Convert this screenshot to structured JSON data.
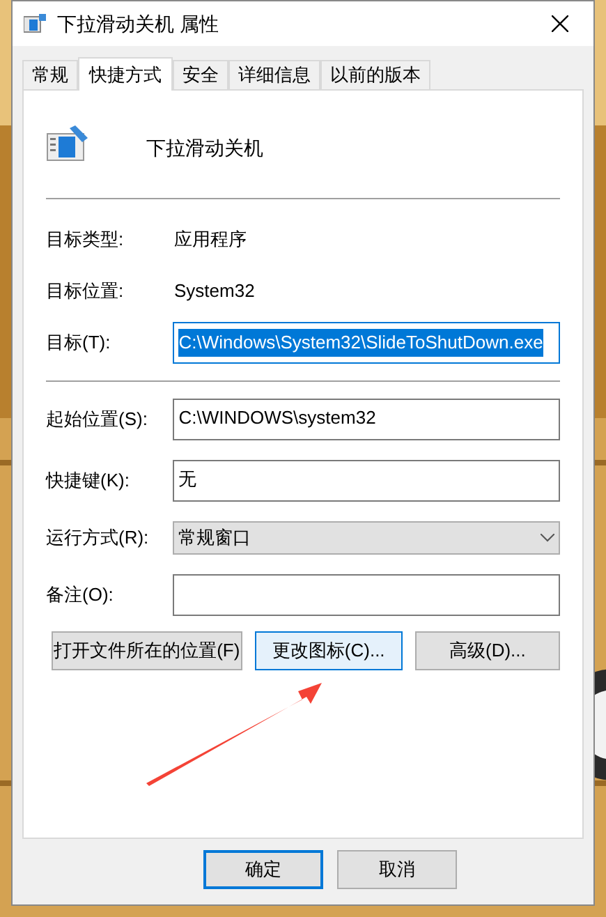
{
  "window": {
    "title": "下拉滑动关机 属性"
  },
  "tabs": [
    {
      "label": "常规",
      "selected": false
    },
    {
      "label": "快捷方式",
      "selected": true
    },
    {
      "label": "安全",
      "selected": false
    },
    {
      "label": "详细信息",
      "selected": false
    },
    {
      "label": "以前的版本",
      "selected": false
    }
  ],
  "shortcut_name": "下拉滑动关机",
  "info_rows": [
    {
      "label": "目标类型:",
      "value": "应用程序"
    },
    {
      "label": "目标位置:",
      "value": "System32"
    }
  ],
  "target": {
    "label": "目标(T):",
    "value": "C:\\Windows\\System32\\SlideToShutDown.exe",
    "selected": true
  },
  "fields": [
    {
      "kind": "text",
      "label": "起始位置(S):",
      "value": "C:\\WINDOWS\\system32"
    },
    {
      "kind": "text",
      "label": "快捷键(K):",
      "value": "无"
    },
    {
      "kind": "dropdown",
      "label": "运行方式(R):",
      "value": "常规窗口"
    },
    {
      "kind": "text",
      "label": "备注(O):"
    }
  ],
  "action_buttons": [
    {
      "label": "打开文件所在的位置(F)",
      "hovered": false
    },
    {
      "label": "更改图标(C)...",
      "hovered": true
    },
    {
      "label": "高级(D)...",
      "hovered": false
    }
  ],
  "dialog_buttons": [
    {
      "label": "确定",
      "default": true
    },
    {
      "label": "取消",
      "default": false
    }
  ]
}
